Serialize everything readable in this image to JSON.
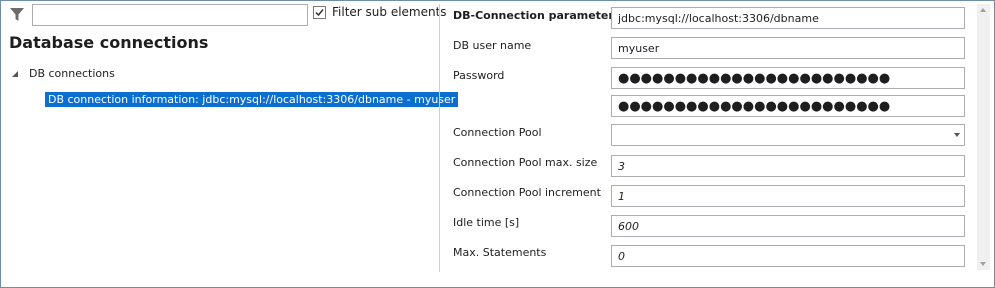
{
  "filter": {
    "icon": "filter-icon",
    "value": "",
    "sub_elements_label": "Filter sub elements",
    "sub_elements_checked": true
  },
  "tree": {
    "title": "Database connections",
    "root_label": "DB connections",
    "root_expanded": true,
    "selected_item": "DB connection information: jdbc:mysql://localhost:3306/dbname - myuser"
  },
  "form": {
    "parameter_label": "DB-Connection parameter",
    "parameter_value": "jdbc:mysql://localhost:3306/dbname",
    "user_label": "DB user name",
    "user_value": "myuser",
    "password_label": "Password",
    "password_value": "●●●●●●●●●●●●●●●●●●●●●●●●",
    "password_confirm_value": "●●●●●●●●●●●●●●●●●●●●●●●●",
    "pool_label": "Connection Pool",
    "pool_value": "",
    "pool_max_label": "Connection Pool max. size",
    "pool_max_value": "3",
    "pool_inc_label": "Connection Pool increment",
    "pool_inc_value": "1",
    "idle_label": "Idle time [s]",
    "idle_value": "600",
    "max_statements_label": "Max. Statements",
    "max_statements_value": "0"
  },
  "colors": {
    "selection": "#0b6fd1",
    "border": "#abadb3",
    "window_border": "#6e8ea8"
  }
}
